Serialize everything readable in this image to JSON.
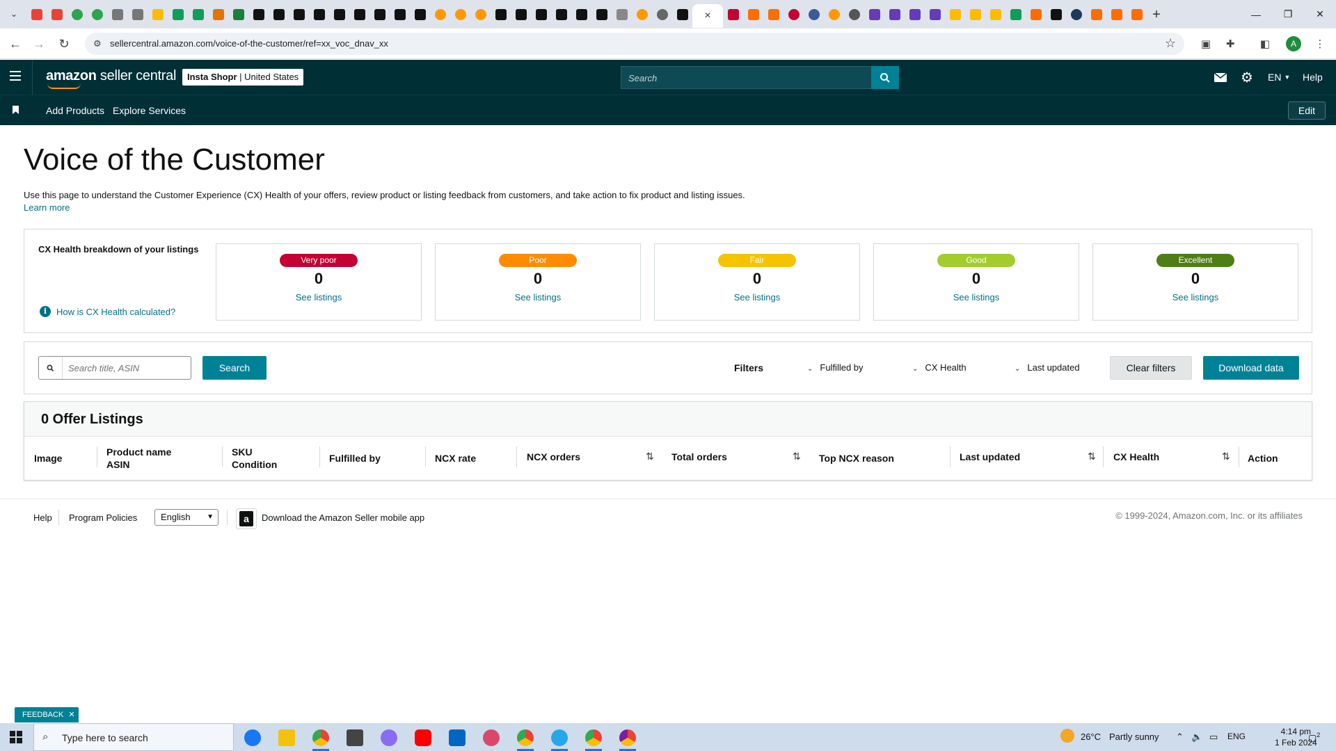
{
  "browser": {
    "url": "sellercentral.amazon.com/voice-of-the-customer/ref=xx_voc_dnav_xx",
    "active_tab_close": "×"
  },
  "colors": {
    "header_bg": "#002f36",
    "teal_accent": "#008296",
    "link": "#007185",
    "very_poor": "#c40233",
    "poor": "#ff8c00",
    "fair": "#f5c400",
    "good": "#a2cd2c",
    "excellent": "#4e7e15"
  },
  "header": {
    "logo_brand": "amazon",
    "logo_rest": " seller central",
    "store_name": "Insta Shopr",
    "store_sep": " | ",
    "store_region": "United States",
    "search_placeholder": "Search",
    "language": "EN",
    "help": "Help"
  },
  "subnav": {
    "links": [
      "Add Products",
      "Explore Services"
    ],
    "edit": "Edit"
  },
  "page": {
    "title": "Voice of the Customer",
    "description": "Use this page to understand the Customer Experience (CX) Health of your offers, review product or listing feedback from customers, and take action to fix product and listing issues.",
    "learn_more": "Learn more"
  },
  "cx_health": {
    "title": "CX Health breakdown of your listings",
    "how_link": "How is CX Health calculated?",
    "cards": [
      {
        "label": "Very poor",
        "count": "0",
        "link": "See listings"
      },
      {
        "label": "Poor",
        "count": "0",
        "link": "See listings"
      },
      {
        "label": "Fair",
        "count": "0",
        "link": "See listings"
      },
      {
        "label": "Good",
        "count": "0",
        "link": "See listings"
      },
      {
        "label": "Excellent",
        "count": "0",
        "link": "See listings"
      }
    ]
  },
  "filters": {
    "search_placeholder": "Search title, ASIN",
    "search_button": "Search",
    "filters_label": "Filters",
    "dropdowns": [
      "Fulfilled by",
      "CX Health",
      "Last updated"
    ],
    "clear": "Clear filters",
    "download": "Download data"
  },
  "listings": {
    "title": "0 Offer Listings",
    "columns": {
      "image": "Image",
      "product_name": "Product name",
      "asin": "ASIN",
      "sku": "SKU",
      "condition": "Condition",
      "fulfilled_by": "Fulfilled by",
      "ncx_rate": "NCX rate",
      "ncx_orders": "NCX orders",
      "total_orders": "Total orders",
      "top_ncx_reason": "Top NCX reason",
      "last_updated": "Last updated",
      "cx_health": "CX Health",
      "action": "Action"
    }
  },
  "footer": {
    "help": "Help",
    "program_policies": "Program Policies",
    "language": "English",
    "app_download": "Download the Amazon Seller mobile app",
    "copyright": "© 1999-2024, Amazon.com, Inc. or its affiliates"
  },
  "feedback": "FEEDBACK",
  "taskbar": {
    "search_placeholder": "Type here to search",
    "weather_temp": "26°C",
    "weather_desc": "Partly sunny",
    "lang": "ENG",
    "time": "4:14 pm",
    "date": "1 Feb 2024",
    "notifications": "2"
  }
}
